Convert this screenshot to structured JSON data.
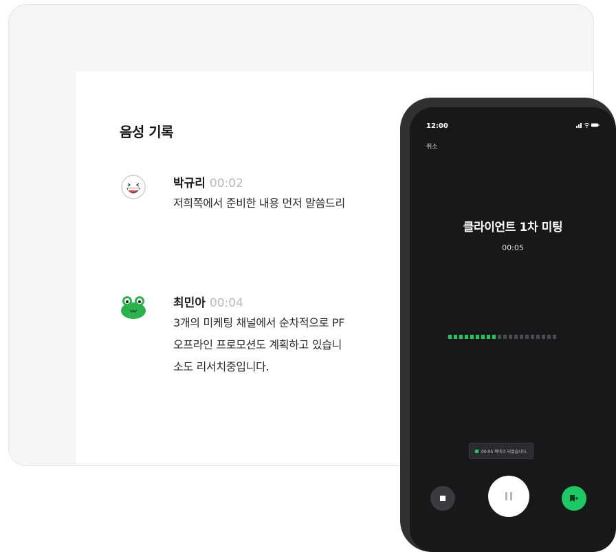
{
  "transcript": {
    "title": "음성 기록",
    "entries": [
      {
        "name": "박규리",
        "time": "00:02",
        "avatar_icon": "laughing-face-icon",
        "lines": [
          "저희쪽에서 준비한 내용 먼저 말씀드리"
        ]
      },
      {
        "name": "최민아",
        "time": "00:04",
        "avatar_icon": "green-frog-icon",
        "lines": [
          "3개의 미케팅 채널에서 순차적으로 PF",
          "오프라인 프로모션도 계획하고 있습니",
          "소도 리서치중입니다."
        ]
      }
    ]
  },
  "phone": {
    "status_time": "12:00",
    "status_icons": "signal-wifi-battery-icons",
    "cancel_label": "취소",
    "meeting_title": "클라이언트 1차 미팅",
    "elapsed": "00:05",
    "waveform": {
      "active_bars": 9,
      "total_bars": 20
    },
    "toast_text": "00:05 북마크 되었습니다.",
    "controls": {
      "stop_icon": "stop-icon",
      "pause_icon": "pause-icon",
      "bookmark_icon": "bookmark-add-icon"
    }
  },
  "colors": {
    "accent": "#1ec864",
    "phone_bg": "#17181a",
    "timestamp": "#b9b9bd"
  }
}
